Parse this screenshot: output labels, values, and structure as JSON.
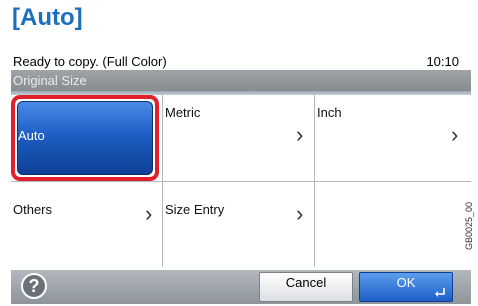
{
  "heading": "[Auto]",
  "status": {
    "text": "Ready to copy. (Full Color)",
    "time": "10:10"
  },
  "screen_title": "Original Size",
  "options": {
    "auto": "Auto",
    "metric": "Metric",
    "inch": "Inch",
    "others": "Others",
    "size_entry": "Size Entry"
  },
  "footer": {
    "help": "?",
    "cancel": "Cancel",
    "ok": "OK"
  },
  "image_code": "GB0025_00",
  "colors": {
    "selection_outline": "#e1202b",
    "selected_fill": "#1d5fc4",
    "heading": "#1c6fbf"
  },
  "icons": [
    "help-icon",
    "chevron-right-icon",
    "enter-icon"
  ]
}
